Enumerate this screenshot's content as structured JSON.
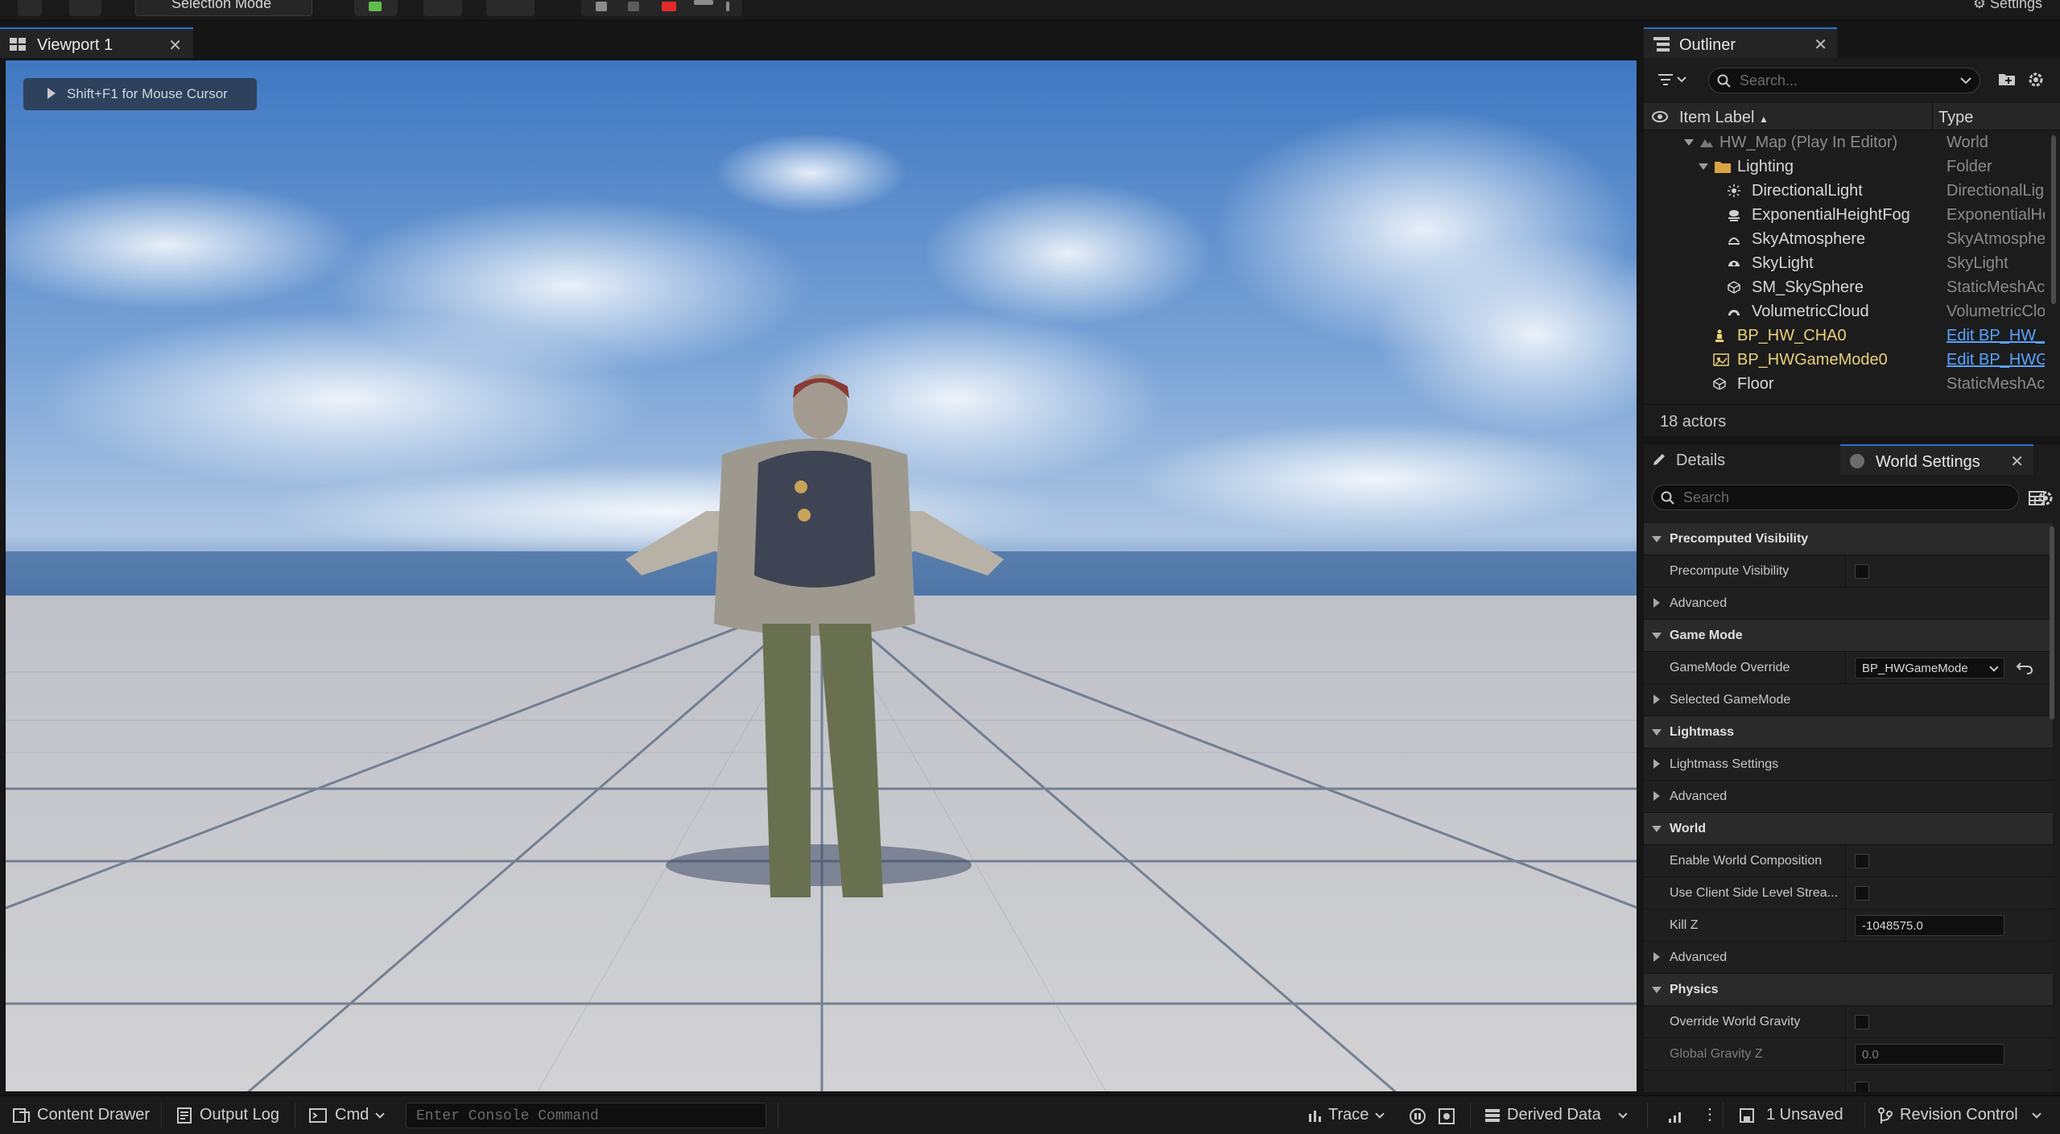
{
  "toolbar": {
    "mode_label": "Selection Mode",
    "settings_label": "Settings"
  },
  "viewport": {
    "tab_label": "Viewport 1",
    "hint_text": "Shift+F1 for Mouse Cursor",
    "colors": {
      "sky_top": "#4a7fc4",
      "sky_horizon": "#b6cbe4",
      "floor": "#c9c9cb",
      "grid_line": "#50607c"
    }
  },
  "outliner": {
    "tab_label": "Outliner",
    "search_placeholder": "Search...",
    "col_label": "Item Label",
    "col_type": "Type",
    "rows": [
      {
        "label": "HW_Map (Play In Editor)",
        "type": "World",
        "icon": "world-icon"
      },
      {
        "label": "Lighting",
        "type": "Folder",
        "icon": "folder-icon"
      },
      {
        "label": "DirectionalLight",
        "type": "DirectionalLig",
        "icon": "directional-light-icon"
      },
      {
        "label": "ExponentialHeightFog",
        "type": "ExponentialHe",
        "icon": "fog-icon"
      },
      {
        "label": "SkyAtmosphere",
        "type": "SkyAtmosphe",
        "icon": "sky-atmosphere-icon"
      },
      {
        "label": "SkyLight",
        "type": "SkyLight",
        "icon": "skylight-icon"
      },
      {
        "label": "SM_SkySphere",
        "type": "StaticMeshAc",
        "icon": "static-mesh-icon"
      },
      {
        "label": "VolumetricCloud",
        "type": "VolumetricClo",
        "icon": "cloud-icon"
      },
      {
        "label": "BP_HW_CHA0",
        "type": "Edit BP_HW_",
        "icon": "character-icon"
      },
      {
        "label": "BP_HWGameMode0",
        "type": "Edit BP_HWG",
        "icon": "gamemode-icon"
      },
      {
        "label": "Floor",
        "type": "StaticMeshAc",
        "icon": "static-mesh-icon"
      }
    ],
    "footer": "18 actors"
  },
  "details": {
    "details_tab": "Details",
    "world_settings_tab": "World Settings",
    "search_placeholder": "Search",
    "rows": [
      {
        "label": "Precomputed Visibility"
      },
      {
        "label": "Precompute Visibility"
      },
      {
        "label": "Advanced"
      },
      {
        "label": "Game Mode"
      },
      {
        "label": "GameMode Override",
        "value": "BP_HWGameMode"
      },
      {
        "label": "Selected GameMode"
      },
      {
        "label": "Lightmass"
      },
      {
        "label": "Lightmass Settings"
      },
      {
        "label": "Advanced"
      },
      {
        "label": "World"
      },
      {
        "label": "Enable World Composition"
      },
      {
        "label": "Use Client Side Level Strea..."
      },
      {
        "label": "Kill Z",
        "value": "-1048575.0"
      },
      {
        "label": "Advanced"
      },
      {
        "label": "Physics"
      },
      {
        "label": "Override World Gravity"
      },
      {
        "label": "Global Gravity Z",
        "value": "0.0"
      }
    ]
  },
  "statusbar": {
    "content_drawer": "Content Drawer",
    "output_log": "Output Log",
    "cmd": "Cmd",
    "console_placeholder": "Enter Console Command",
    "trace": "Trace",
    "derived_data": "Derived Data",
    "unsaved": "1 Unsaved",
    "revision_control": "Revision Control"
  }
}
